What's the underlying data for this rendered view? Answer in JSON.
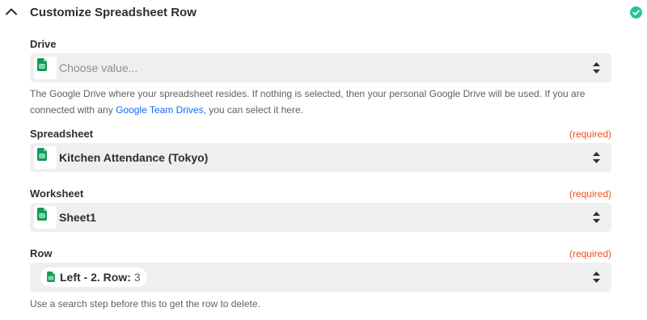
{
  "header": {
    "title": "Customize Spreadsheet Row"
  },
  "fields": {
    "drive": {
      "label": "Drive",
      "placeholder": "Choose value...",
      "help_before": "The Google Drive where your spreadsheet resides. If nothing is selected, then your personal Google Drive will be used. If you are connected with any ",
      "help_link": "Google Team Drives",
      "help_after": ", you can select it here."
    },
    "spreadsheet": {
      "label": "Spreadsheet",
      "required": "(required)",
      "value": "Kitchen Attendance (Tokyo)"
    },
    "worksheet": {
      "label": "Worksheet",
      "required": "(required)",
      "value": "Sheet1"
    },
    "row": {
      "label": "Row",
      "required": "(required)",
      "pill_label": "Left - 2. Row:",
      "pill_value": "3",
      "help": "Use a search step before this to get the row to delete."
    }
  },
  "colors": {
    "required": "#e8521f",
    "link": "#136bf5",
    "status_success": "#24c59c",
    "sheets_green": "#0f9d58",
    "field_background": "#efefef"
  },
  "icons": {
    "collapse": "chevron-up-icon",
    "status": "check-circle-icon",
    "app": "google-sheets-icon",
    "select": "up-down-arrows-icon"
  }
}
